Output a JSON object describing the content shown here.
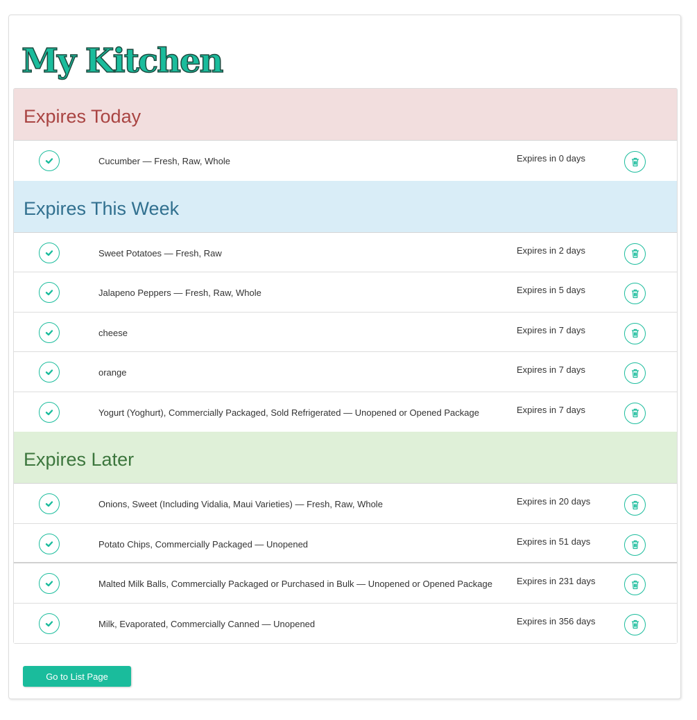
{
  "page": {
    "title": "My Kitchen",
    "button_label": "Go to List Page"
  },
  "sections": [
    {
      "id": "today",
      "heading": "Expires Today",
      "items": [
        {
          "name": "Cucumber — Fresh, Raw, Whole",
          "expires": "Expires in 0 days"
        }
      ]
    },
    {
      "id": "week",
      "heading": "Expires This Week",
      "items": [
        {
          "name": "Sweet Potatoes — Fresh, Raw",
          "expires": "Expires in 2 days"
        },
        {
          "name": "Jalapeno Peppers — Fresh, Raw, Whole",
          "expires": "Expires in 5 days"
        },
        {
          "name": "cheese",
          "expires": "Expires in 7 days"
        },
        {
          "name": "orange",
          "expires": "Expires in 7 days"
        },
        {
          "name": "Yogurt (Yoghurt), Commercially Packaged, Sold Refrigerated — Unopened or Opened Package",
          "expires": "Expires in 7 days"
        }
      ]
    },
    {
      "id": "later",
      "heading": "Expires Later",
      "items": [
        {
          "name": "Onions, Sweet (Including Vidalia, Maui Varieties) — Fresh, Raw, Whole",
          "expires": "Expires in 20 days"
        },
        {
          "name": "Potato Chips, Commercially Packaged — Unopened",
          "expires": "Expires in 51 days"
        },
        {
          "name": "Malted Milk Balls, Commercially Packaged or Purchased in Bulk — Unopened or Opened Package",
          "expires": "Expires in 231 days"
        },
        {
          "name": "Milk, Evaporated, Commercially Canned — Unopened",
          "expires": "Expires in 356 days"
        }
      ]
    }
  ],
  "icons": {
    "check": "check-circle-icon",
    "trash": "trash-icon"
  },
  "colors": {
    "accent": "#1abc9c",
    "today_bg": "#f2dede",
    "today_text": "#a94442",
    "week_bg": "#d9edf7",
    "week_text": "#31708f",
    "later_bg": "#dff0d8",
    "later_text": "#3c763d"
  }
}
